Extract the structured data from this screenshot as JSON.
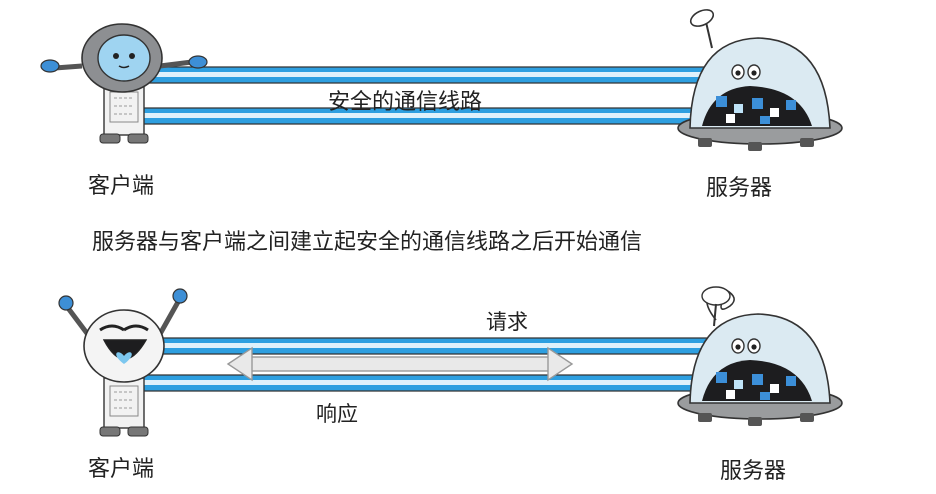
{
  "top": {
    "client_label": "客户端",
    "server_label": "服务器",
    "channel_label": "安全的通信线路"
  },
  "caption": "服务器与客户端之间建立起安全的通信线路之后开始通信",
  "bottom": {
    "client_label": "客户端",
    "server_label": "服务器",
    "request_label": "请求",
    "response_label": "响应"
  },
  "colors": {
    "channel_blue": "#2e9fe0",
    "channel_highlight": "#dff1fb",
    "robot_body": "#f2f2f2",
    "robot_head_dark": "#8d8f92",
    "face_blue": "#9fd4f1",
    "server_dome": "#dbeaf2",
    "server_base": "#9a9c9e",
    "arrow_gray": "#b9b9b9"
  }
}
